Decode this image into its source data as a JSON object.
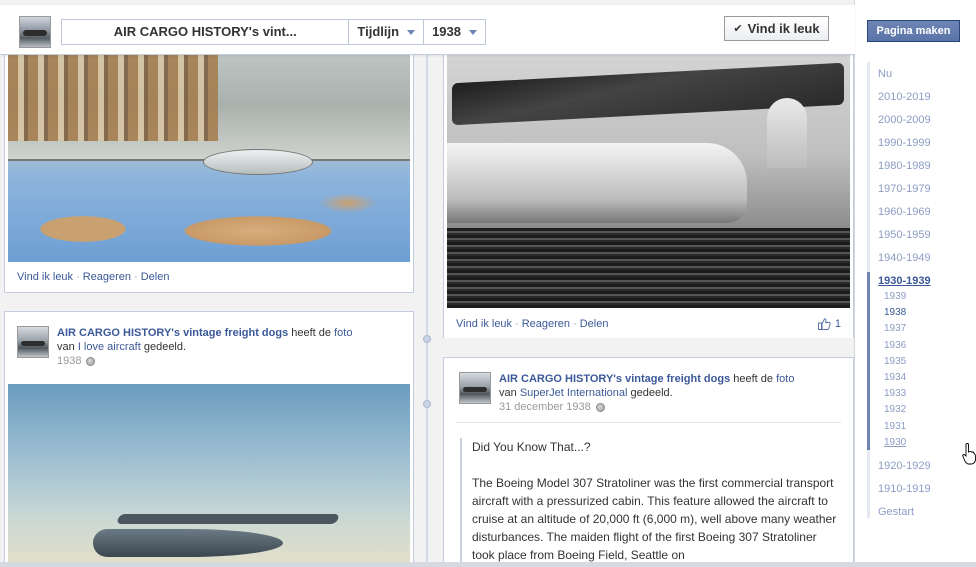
{
  "header": {
    "page_title": "AIR CARGO HISTORY's vint...",
    "section_dropdown": "Tijdlijn",
    "year_dropdown": "1938",
    "like_button": "Vind ik leuk"
  },
  "sidebar": {
    "create_page_button": "Pagina maken",
    "decades_top": [
      "Nu",
      "2010-2019",
      "2000-2009",
      "1990-1999",
      "1980-1989",
      "1970-1979",
      "1960-1969",
      "1950-1959",
      "1940-1949"
    ],
    "active_decade": "1930-1939",
    "years": [
      "1939",
      "1938",
      "1937",
      "1936",
      "1935",
      "1934",
      "1933",
      "1932",
      "1931",
      "1930"
    ],
    "decades_bottom": [
      "1920-1929",
      "1910-1919",
      "Gestart"
    ]
  },
  "post_top_left": {
    "actions": [
      "Vind ik leuk",
      "Reageren",
      "Delen"
    ]
  },
  "post_top_right": {
    "actions": [
      "Vind ik leuk",
      "Reageren",
      "Delen"
    ],
    "like_count": "1"
  },
  "post_left": {
    "author": "AIR CARGO HISTORY's vintage freight dogs",
    "shared_text": "heeft de",
    "shared_link": "foto",
    "from_text": "van",
    "source": "I love aircraft",
    "shared_suffix": "gedeeld.",
    "date": "1938"
  },
  "post_right": {
    "author": "AIR CARGO HISTORY's vintage freight dogs",
    "shared_text": "heeft de",
    "shared_link": "foto",
    "from_text": "van",
    "source": "SuperJet International",
    "shared_suffix": "gedeeld.",
    "date": "31 december 1938",
    "quote_title": "Did You Know That...?",
    "quote_body": "The Boeing Model 307 Stratoliner was the first commercial transport aircraft with a pressurized cabin. This feature allowed the aircraft to cruise at an altitude of 20,000 ft (6,000 m), well above many weather disturbances. The maiden flight of the first Boeing 307 Stratoliner took place from Boeing Field, Seattle on"
  },
  "colors": {
    "link": "#3b5998",
    "button_blue": "#6d84b4",
    "timeline_bg": "#f2f2f2"
  }
}
